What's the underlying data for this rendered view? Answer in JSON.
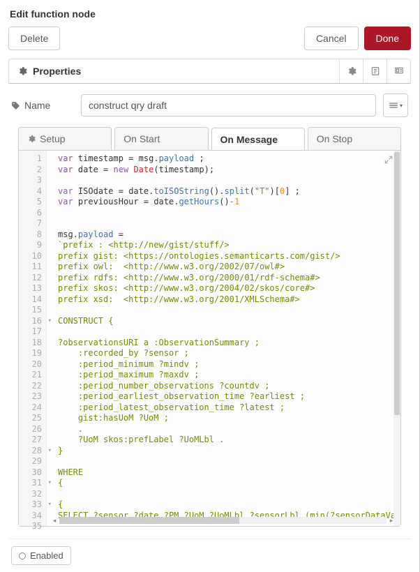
{
  "dialog": {
    "title": "Edit function node"
  },
  "buttons": {
    "delete": "Delete",
    "cancel": "Cancel",
    "done": "Done"
  },
  "section": {
    "properties": "Properties"
  },
  "form": {
    "name_label": "Name",
    "name_value": "construct qry draft"
  },
  "tabs": {
    "setup": "Setup",
    "on_start": "On Start",
    "on_message": "On Message",
    "on_stop": "On Stop"
  },
  "footer": {
    "enabled": "Enabled"
  },
  "editor": {
    "lines": [
      {
        "n": "1",
        "t": "<span class='tok-kw'>var</span> <span class='tok-var'>timestamp</span> = <span class='tok-var'>msg</span>.<span class='tok-func'>payload</span> ;"
      },
      {
        "n": "2",
        "t": "<span class='tok-kw'>var</span> <span class='tok-var'>date</span> = <span class='tok-kw'>new</span> <span class='tok-type'>Date</span>(<span class='tok-var'>timestamp</span>);"
      },
      {
        "n": "3",
        "t": ""
      },
      {
        "n": "4",
        "t": "<span class='tok-kw'>var</span> <span class='tok-var'>ISOdate</span> = <span class='tok-var'>date</span>.<span class='tok-func'>toISOString</span>().<span class='tok-func'>split</span>(<span class='tok-str'>\"T\"</span>)[<span class='tok-num'>0</span>] ;"
      },
      {
        "n": "5",
        "t": "<span class='tok-kw'>var</span> <span class='tok-var'>previousHour</span> = <span class='tok-var'>date</span>.<span class='tok-func'>getHours</span>()<span class='tok-op'>-</span><span class='tok-num'>1</span>"
      },
      {
        "n": "6",
        "t": ""
      },
      {
        "n": "7",
        "t": ""
      },
      {
        "n": "8",
        "t": "<span class='tok-var'>msg</span>.<span class='tok-func'>payload</span> ="
      },
      {
        "n": "9",
        "t": "<span class='tok-str'>`prefix : &lt;http://new/gist/stuff/&gt;</span>"
      },
      {
        "n": "10",
        "t": "<span class='tok-str'>prefix gist: &lt;https://ontologies.semanticarts.com/gist/&gt;</span>"
      },
      {
        "n": "11",
        "t": "<span class='tok-str'>prefix owl:  &lt;http://www.w3.org/2002/07/owl#&gt;</span>"
      },
      {
        "n": "12",
        "t": "<span class='tok-str'>prefix rdfs: &lt;http://www.w3.org/2000/01/rdf-schema#&gt;</span>"
      },
      {
        "n": "13",
        "t": "<span class='tok-str'>prefix skos: &lt;http://www.w3.org/2004/02/skos/core#&gt;</span>"
      },
      {
        "n": "14",
        "t": "<span class='tok-str'>prefix xsd:  &lt;http://www.w3.org/2001/XMLSchema#&gt;</span>"
      },
      {
        "n": "15",
        "t": ""
      },
      {
        "n": "16",
        "t": "<span class='tok-str'>CONSTRUCT {</span>",
        "fold": true
      },
      {
        "n": "17",
        "t": ""
      },
      {
        "n": "18",
        "t": "<span class='tok-str'>?observationsURI a :ObservationSummary ;</span>"
      },
      {
        "n": "19",
        "t": "<span class='tok-str'>    :recorded_by ?sensor ;</span>"
      },
      {
        "n": "20",
        "t": "<span class='tok-str'>    :period_minimum ?mindv ;</span>"
      },
      {
        "n": "21",
        "t": "<span class='tok-str'>    :period_maximum ?maxdv ;</span>"
      },
      {
        "n": "22",
        "t": "<span class='tok-str'>    :period_number_observations ?countdv ;</span>"
      },
      {
        "n": "23",
        "t": "<span class='tok-str'>    :period_earliest_observation_time ?earliest ;</span>"
      },
      {
        "n": "24",
        "t": "<span class='tok-str'>    :period_latest_observation_time ?latest ;</span>"
      },
      {
        "n": "25",
        "t": "<span class='tok-str'>    gist:hasUoM ?UoM ;</span>"
      },
      {
        "n": "26",
        "t": "<span class='tok-str'>    .</span>"
      },
      {
        "n": "27",
        "t": "<span class='tok-str'>    ?UoM skos:prefLabel ?UoMLbl .</span>"
      },
      {
        "n": "28",
        "t": "<span class='tok-str'>}</span>",
        "fold": true
      },
      {
        "n": "29",
        "t": ""
      },
      {
        "n": "30",
        "t": "<span class='tok-str'>WHERE</span>"
      },
      {
        "n": "31",
        "t": "<span class='tok-str'>{</span>",
        "fold": true
      },
      {
        "n": "32",
        "t": ""
      },
      {
        "n": "33",
        "t": "<span class='tok-str'>{</span>",
        "fold": true
      },
      {
        "n": "34",
        "t": "<span class='tok-str'>SELECT ?sensor ?date ?PM ?UoM ?UoMLbl ?sensorLbl (min(?sensorDataValu</span>"
      },
      {
        "n": "35",
        "t": ""
      }
    ]
  }
}
